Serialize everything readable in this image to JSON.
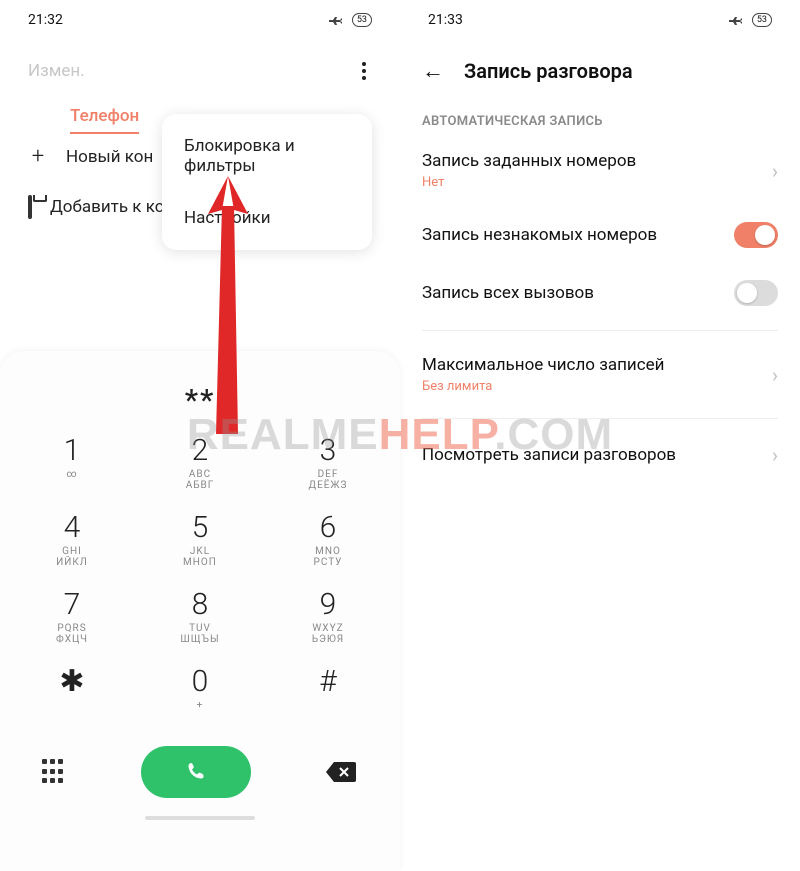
{
  "left": {
    "status_time": "21:32",
    "battery": "53",
    "edit_label": "Измен.",
    "tab_phone": "Телефон",
    "new_contact": "Новый кон",
    "add_to_contact": "Добавить к конта    у",
    "popover": {
      "block": "Блокировка и фильтры",
      "settings": "Настройки"
    },
    "dialed": "**",
    "keys": [
      {
        "d": "1",
        "lat": "∞",
        "cyr": " "
      },
      {
        "d": "2",
        "lat": "ABC",
        "cyr": "АБВГ"
      },
      {
        "d": "3",
        "lat": "DEF",
        "cyr": "ДЕЁЖЗ"
      },
      {
        "d": "4",
        "lat": "GHI",
        "cyr": "ИЙКЛ"
      },
      {
        "d": "5",
        "lat": "JKL",
        "cyr": "МНОП"
      },
      {
        "d": "6",
        "lat": "MNO",
        "cyr": "РСТУ"
      },
      {
        "d": "7",
        "lat": "PQRS",
        "cyr": "ФХЦЧ"
      },
      {
        "d": "8",
        "lat": "TUV",
        "cyr": "ШЩЪЫ"
      },
      {
        "d": "9",
        "lat": "WXYZ",
        "cyr": "ЬЭЮЯ"
      },
      {
        "d": "✱",
        "lat": "",
        "cyr": ""
      },
      {
        "d": "0",
        "lat": "+",
        "cyr": ""
      },
      {
        "d": "#",
        "lat": "",
        "cyr": ""
      }
    ]
  },
  "right": {
    "status_time": "21:33",
    "battery": "53",
    "page_title": "Запись разговора",
    "section": "АВТОМАТИЧЕСКАЯ ЗАПИСЬ",
    "rec_given": "Запись заданных номеров",
    "rec_given_sub": "Нет",
    "rec_unknown": "Запись незнакомых номеров",
    "rec_all": "Запись всех вызовов",
    "max_count": "Максимальное число записей",
    "max_count_sub": "Без лимита",
    "view_recs": "Посмотреть записи разговоров"
  },
  "watermark": {
    "a": "REALME",
    "b": "HELP",
    "c": ".COM"
  }
}
